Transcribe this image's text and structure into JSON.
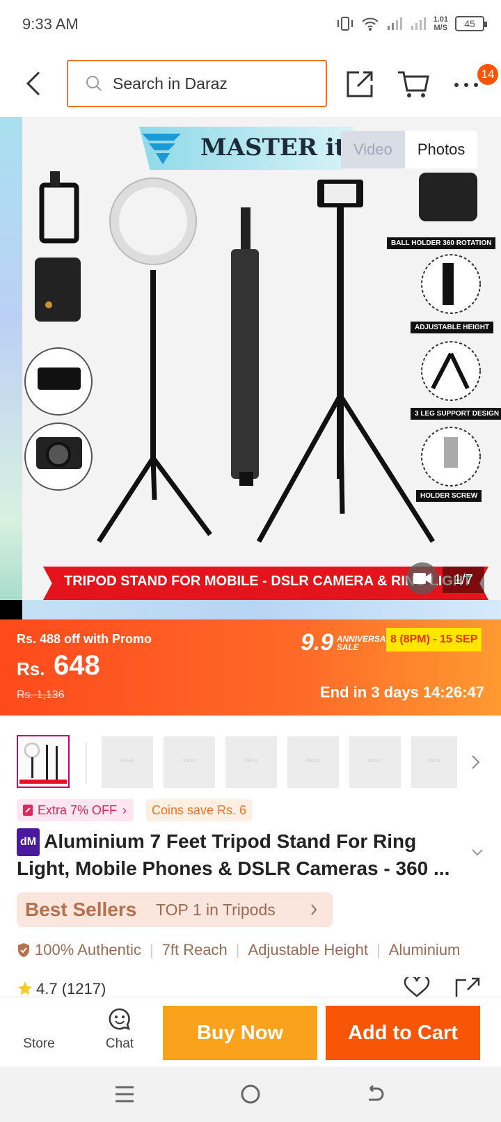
{
  "status": {
    "time": "9:33 AM",
    "speed_top": "1.01",
    "speed_unit": "M/S",
    "battery": "45"
  },
  "header": {
    "search_placeholder": "Search in Daraz",
    "cart_badge": "14"
  },
  "gallery": {
    "tabs": [
      "Video",
      "Photos"
    ],
    "brand": "MASTER it",
    "banner": "TRIPOD STAND FOR MOBILE - DSLR CAMERA  & RING LIGHT",
    "feature_labels": [
      "BALL HOLDER 360 ROTATION",
      "ADJUSTABLE HEIGHT",
      "3 LEG SUPPORT DESIGN",
      "HOLDER SCREW"
    ],
    "counter": "1/7"
  },
  "promo": {
    "off_text": "Rs. 488 off with Promo",
    "currency": "Rs.",
    "price": "648",
    "original_price": "Rs. 1,136",
    "campaign_number": "9.9",
    "campaign_line1": "ANNIVERSARY",
    "campaign_line2": "SALE",
    "campaign_dates": "8 (8PM) - 15 SEP",
    "countdown": "End in 3 days 14:26:47"
  },
  "thumb_placeholder": "daraz",
  "tags": {
    "extra_off": "Extra 7% OFF",
    "coins": "Coins save Rs. 6"
  },
  "product": {
    "badge": "dM",
    "title": "Aluminium 7 Feet Tripod Stand For Ring Light, Mobile Phones & DSLR Cameras - 360 ..."
  },
  "best_sellers": {
    "label": "Best Sellers",
    "rank": "TOP 1 in Tripods"
  },
  "features": [
    "100% Authentic",
    "7ft Reach",
    "Adjustable Height",
    "Aluminium"
  ],
  "rating": {
    "score": "4.7",
    "count": "(1217)",
    "stars_value": 4.7
  },
  "bottom": {
    "store": "Store",
    "chat": "Chat",
    "buy_now": "Buy Now",
    "add_to_cart": "Add to Cart"
  },
  "colors": {
    "brand_orange": "#f85606",
    "buy_yellow": "#faa21b",
    "promo_start": "#ff4a1c",
    "promo_end": "#ff9a30"
  }
}
